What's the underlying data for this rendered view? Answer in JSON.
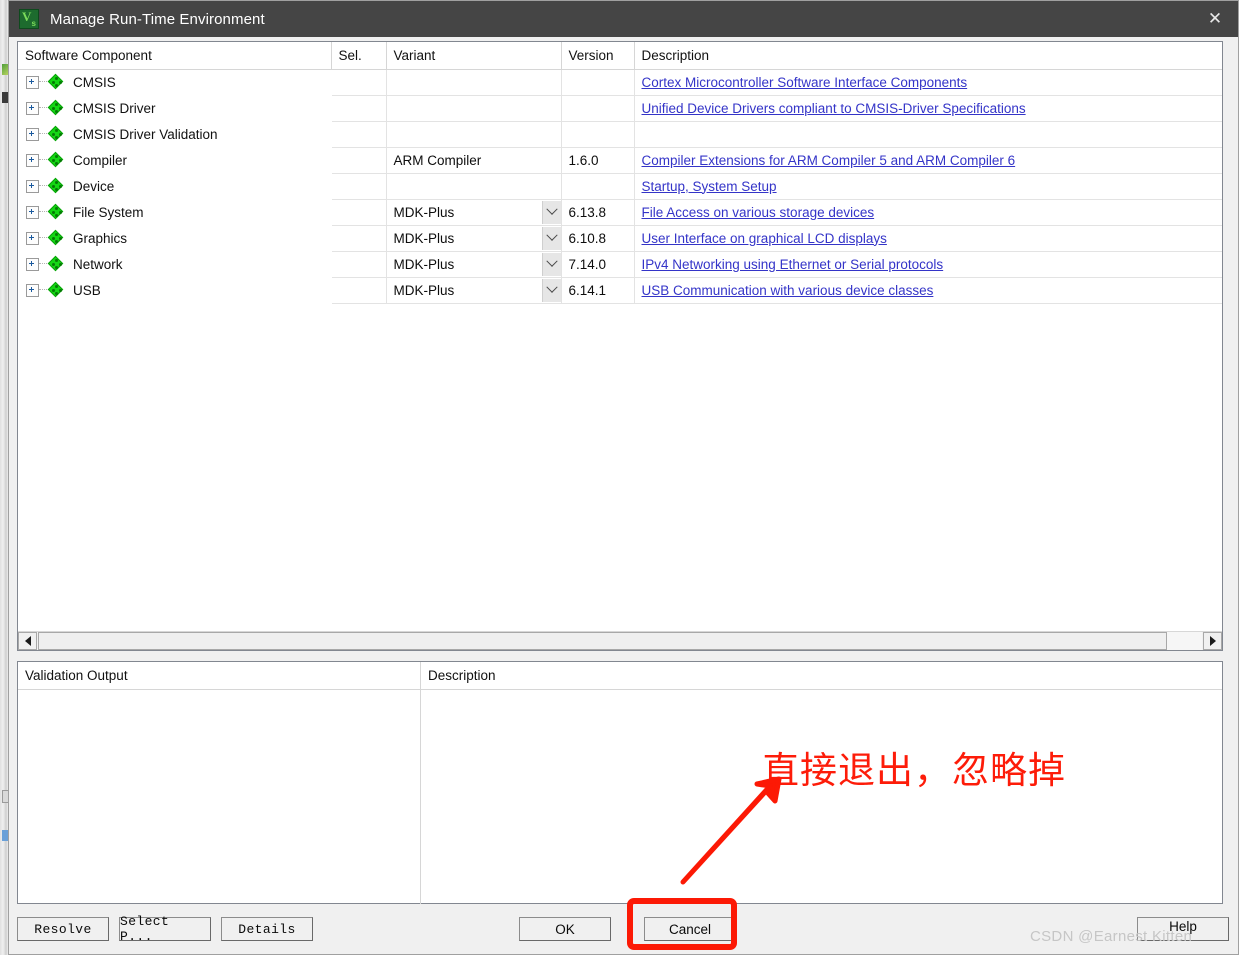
{
  "window": {
    "title": "Manage Run-Time Environment",
    "app_icon": "uvision-logo-icon",
    "close_label": "✕"
  },
  "component_table": {
    "columns": [
      {
        "key": "name",
        "label": "Software Component"
      },
      {
        "key": "sel",
        "label": "Sel."
      },
      {
        "key": "variant",
        "label": "Variant"
      },
      {
        "key": "version",
        "label": "Version"
      },
      {
        "key": "desc",
        "label": "Description"
      }
    ],
    "rows": [
      {
        "name": "CMSIS",
        "sel": "",
        "variant": "",
        "has_dropdown": false,
        "version": "",
        "desc": "Cortex Microcontroller Software Interface Components"
      },
      {
        "name": "CMSIS Driver",
        "sel": "",
        "variant": "",
        "has_dropdown": false,
        "version": "",
        "desc": "Unified Device Drivers compliant to CMSIS-Driver Specifications"
      },
      {
        "name": "CMSIS Driver Validation",
        "sel": "",
        "variant": "",
        "has_dropdown": false,
        "version": "",
        "desc": ""
      },
      {
        "name": "Compiler",
        "sel": "",
        "variant": "ARM Compiler",
        "has_dropdown": false,
        "version": "1.6.0",
        "desc": "Compiler Extensions for ARM Compiler 5 and ARM Compiler 6"
      },
      {
        "name": "Device",
        "sel": "",
        "variant": "",
        "has_dropdown": false,
        "version": "",
        "desc": "Startup, System Setup"
      },
      {
        "name": "File System",
        "sel": "",
        "variant": "MDK-Plus",
        "has_dropdown": true,
        "version": "6.13.8",
        "desc": "File Access on various storage devices"
      },
      {
        "name": "Graphics",
        "sel": "",
        "variant": "MDK-Plus",
        "has_dropdown": true,
        "version": "6.10.8",
        "desc": "User Interface on graphical LCD displays"
      },
      {
        "name": "Network",
        "sel": "",
        "variant": "MDK-Plus",
        "has_dropdown": true,
        "version": "7.14.0",
        "desc": "IPv4 Networking using Ethernet or Serial protocols"
      },
      {
        "name": "USB",
        "sel": "",
        "variant": "MDK-Plus",
        "has_dropdown": true,
        "version": "6.14.1",
        "desc": "USB Communication with various device classes"
      }
    ],
    "scrollbar": {
      "left_arrow": "scroll-left-icon",
      "right_arrow": "scroll-right-icon"
    }
  },
  "validation": {
    "output_header": "Validation Output",
    "description_header": "Description",
    "rows": []
  },
  "buttons": {
    "resolve": "Resolve",
    "select_packs": "Select P...",
    "details": "Details",
    "ok": "OK",
    "cancel": "Cancel",
    "help": "Help"
  },
  "annotations": {
    "note_text": "直接退出，忽略掉",
    "note_color": "#fd1c09",
    "highlight_target": "cancel-button",
    "watermark": "CSDN @Earnest Kitten"
  }
}
